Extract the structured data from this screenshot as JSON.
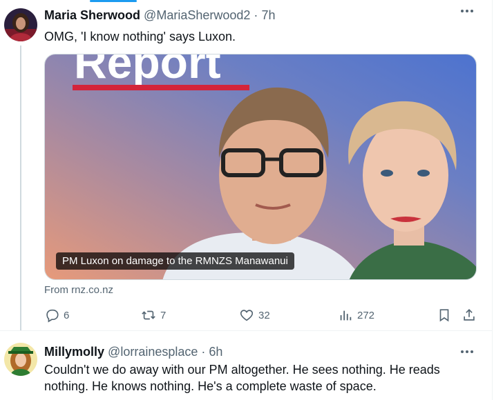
{
  "tweet1": {
    "name": "Maria Sherwood",
    "handle": "@MariaSherwood2",
    "separator": "·",
    "time": "7h",
    "text": "OMG, 'I know nothing' says Luxon.",
    "card": {
      "brand_text": "Report",
      "caption": "PM Luxon on damage to the RMNZS Manawanui",
      "source": "From rnz.co.nz"
    },
    "actions": {
      "replies": "6",
      "reposts": "7",
      "likes": "32",
      "views": "272"
    }
  },
  "tweet2": {
    "name": "Millymolly",
    "handle": "@lorrainesplace",
    "separator": "·",
    "time": "6h",
    "text_line1": "Couldn't we do away with our PM altogether. He sees nothing. He reads",
    "text_line2": "nothing. He knows nothing. He's a complete waste of space."
  },
  "icons": {
    "more": "more-horizontal-icon",
    "reply": "reply-icon",
    "repost": "repost-icon",
    "like": "heart-icon",
    "views": "views-chart-icon",
    "bookmark": "bookmark-icon",
    "share": "share-icon"
  },
  "colors": {
    "accent": "#1d9bf0",
    "secondary_text": "#536471",
    "brand_red": "#d4243a"
  }
}
